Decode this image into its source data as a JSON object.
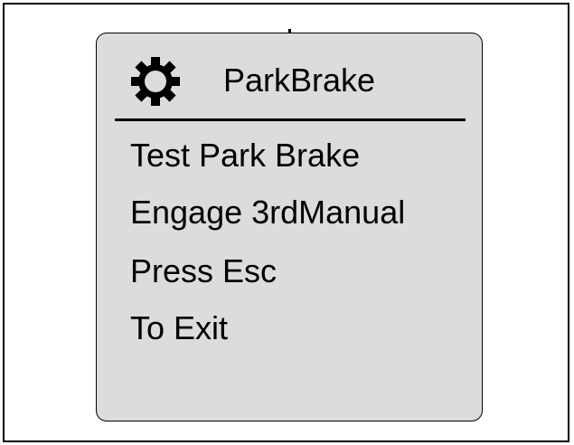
{
  "screen": {
    "title": "ParkBrake",
    "header_icon": "gear-icon",
    "lines": [
      "Test Park Brake",
      "Engage 3rdManual",
      "Press Esc",
      "To Exit"
    ]
  },
  "colors": {
    "panel_background": "#dcdcdc",
    "text": "#000000",
    "frame": "#000000"
  }
}
